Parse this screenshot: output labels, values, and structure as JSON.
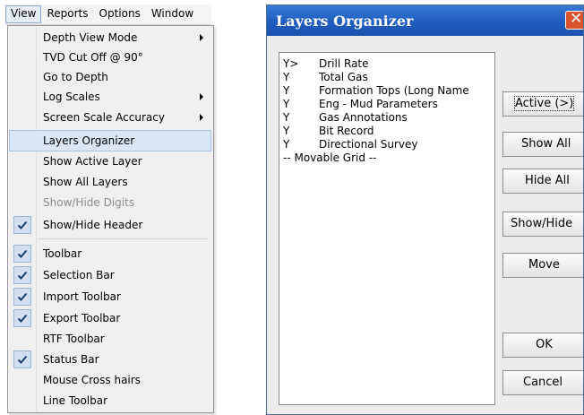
{
  "menubar": {
    "items": [
      {
        "label": "View"
      },
      {
        "label": "Reports"
      },
      {
        "label": "Options"
      },
      {
        "label": "Window"
      }
    ]
  },
  "view_menu": {
    "items": [
      {
        "label": "Depth View Mode",
        "submenu": true
      },
      {
        "label": "TVD Cut Off @ 90°"
      },
      {
        "label": "Go to Depth"
      },
      {
        "label": "Log Scales",
        "submenu": true
      },
      {
        "label": "Screen Scale Accuracy",
        "submenu": true
      },
      {
        "label": "Layers Organizer",
        "highlighted": true
      },
      {
        "label": "Show Active Layer"
      },
      {
        "label": "Show All Layers"
      },
      {
        "label": "Show/Hide Digits",
        "disabled": true
      },
      {
        "label": "Show/Hide Header",
        "checked": true
      },
      {
        "label": "Toolbar",
        "checked": true
      },
      {
        "label": "Selection Bar",
        "checked": true
      },
      {
        "label": "Import Toolbar",
        "checked": true
      },
      {
        "label": "Export Toolbar",
        "checked": true
      },
      {
        "label": "RTF Toolbar"
      },
      {
        "label": "Status Bar",
        "checked": true
      },
      {
        "label": "Mouse Cross hairs"
      },
      {
        "label": "Line Toolbar"
      }
    ]
  },
  "dialog": {
    "title": "Layers Organizer",
    "close_icon": "close-icon",
    "layers": [
      {
        "flag": "Y>",
        "name": "Drill Rate"
      },
      {
        "flag": "Y",
        "name": "Total Gas"
      },
      {
        "flag": "Y",
        "name": "Formation Tops (Long Name"
      },
      {
        "flag": "Y",
        "name": "Eng - Mud Parameters"
      },
      {
        "flag": "Y",
        "name": "Gas Annotations"
      },
      {
        "flag": "Y",
        "name": "Bit Record"
      },
      {
        "flag": "Y",
        "name": "Directional Survey"
      },
      {
        "flag": "",
        "name": "-- Movable Grid --"
      }
    ],
    "buttons": {
      "active": "Active (>)",
      "show_all": "Show All",
      "hide_all": "Hide All",
      "show_hide": "Show/Hide",
      "move": "Move",
      "ok": "OK",
      "cancel": "Cancel"
    }
  },
  "colors": {
    "titlebar": "#1f5bc0",
    "close_button": "#d9542c",
    "menu_highlight": "#d9e6f5",
    "check_bg": "#d2dff0"
  }
}
